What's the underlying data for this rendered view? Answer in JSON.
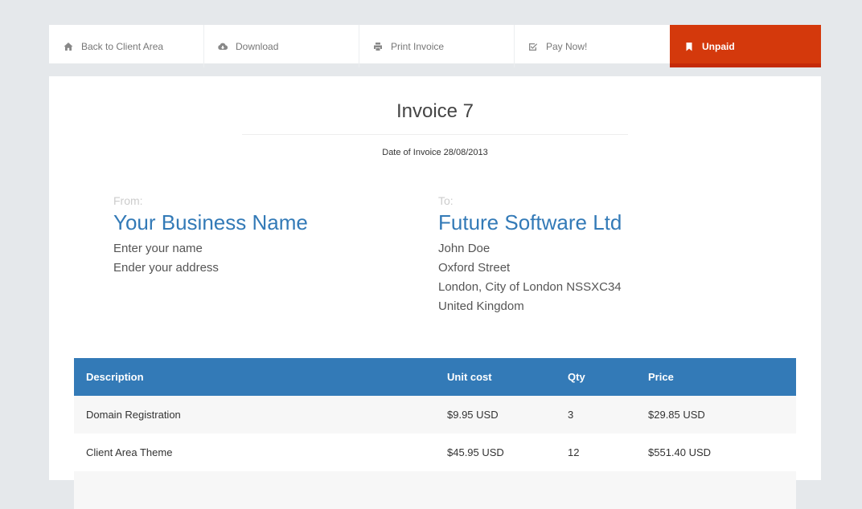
{
  "toolbar": {
    "back_label": "Back to Client Area",
    "download_label": "Download",
    "print_label": "Print Invoice",
    "pay_label": "Pay Now!",
    "status_label": "Unpaid",
    "icons": {
      "back": "home-icon",
      "download": "cloud-download-icon",
      "print": "print-icon",
      "pay": "check-square-icon",
      "status": "bookmark-icon"
    },
    "status_color": "#d4390c"
  },
  "invoice": {
    "title": "Invoice 7",
    "date_text": "Date of Invoice 28/08/2013"
  },
  "from": {
    "label": "From:",
    "name": "Your Business Name",
    "lines": [
      "Enter your name",
      "Ender your address"
    ]
  },
  "to": {
    "label": "To:",
    "name": "Future Software Ltd",
    "lines": [
      "John Doe",
      "Oxford Street",
      "London, City of London NSSXC34",
      "United Kingdom"
    ]
  },
  "table": {
    "headers": [
      "Description",
      "Unit cost",
      "Qty",
      "Price"
    ],
    "rows": [
      [
        "Domain Registration",
        "$9.95 USD",
        "3",
        "$29.85 USD"
      ],
      [
        "Client Area Theme",
        "$45.95 USD",
        "12",
        "$551.40 USD"
      ]
    ],
    "header_color": "#337ab7"
  }
}
